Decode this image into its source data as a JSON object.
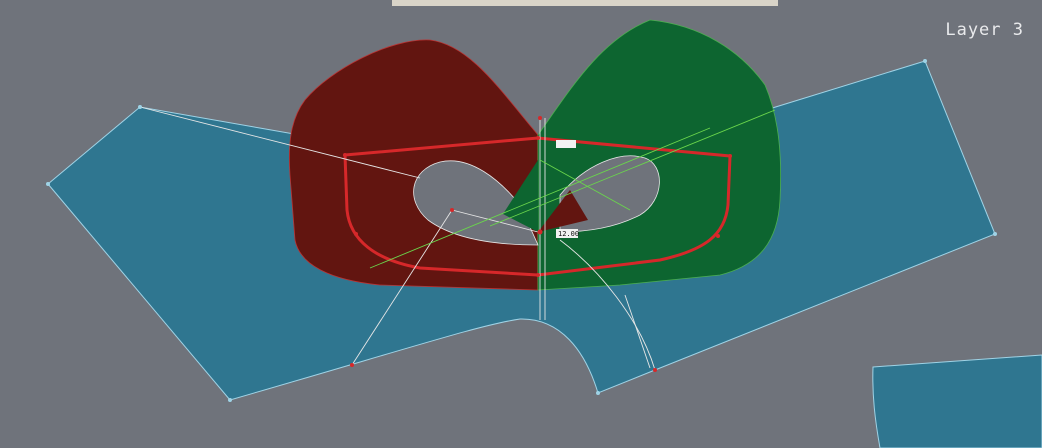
{
  "view": {
    "layer_label": "Layer 3",
    "dimension_label": "12.00"
  },
  "colors": {
    "background": "#6f737b",
    "teal_piece": "#2f7690",
    "red_piece": "#621510",
    "green_piece": "#0d6530",
    "outline": "#d6282a",
    "guide_white": "#e6e6e6",
    "guide_green": "#6ad64c"
  }
}
